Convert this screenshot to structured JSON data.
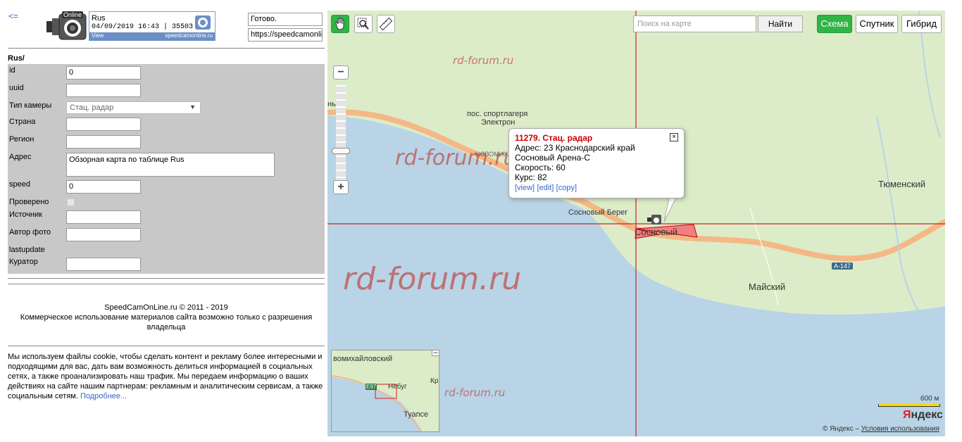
{
  "left": {
    "back_label": "<=",
    "logo_text": "Online",
    "infobox": {
      "country": "Rus",
      "datetime_id": "04/09/2019 16:43 | 35503",
      "view_label": "View",
      "site": "speedcamonline.ru"
    },
    "status": "Готово.",
    "url": "https://speedcamonline.ru",
    "form": {
      "title": "Rus/",
      "fields": {
        "id_label": "id",
        "id_value": "0",
        "uuid_label": "uuid",
        "uuid_value": "",
        "type_label": "Тип камеры",
        "type_value": "Стац. радар",
        "country_label": "Страна",
        "country_value": "",
        "region_label": "Регион",
        "region_value": "",
        "address_label": "Адрес",
        "address_value": "Обзорная карта по таблице Rus",
        "speed_label": "speed",
        "speed_value": "0",
        "checked_label": "Проверено",
        "source_label": "Источник",
        "source_value": "",
        "photo_author_label": "Автор фото",
        "photo_author_value": "",
        "lastupdate_label": "lastupdate",
        "curator_label": "Куратор",
        "curator_value": ""
      }
    },
    "footer": {
      "line1": "SpeedCamOnLine.ru © 2011 - 2019",
      "line2": "Коммерческое использование материалов сайта возможно только с разрешения владельца"
    },
    "cookie": {
      "text": "Мы используем файлы cookie, чтобы сделать контент и рекламу более интересными и подходящими для вас, дать вам возможность делиться информацией в социальных сетях, а также проанализировать наш трафик. Мы передаем информацию о ваших действиях на сайте нашим партнерам: рекламным и аналитическим сервисам, а также социальным сетям. ",
      "more_link": "Подробнее..."
    }
  },
  "map": {
    "search_placeholder": "Поиск на карте",
    "search_button": "Найти",
    "types": {
      "scheme": "Схема",
      "satellite": "Спутник",
      "hybrid": "Гибрид"
    },
    "zoom_plus": "+",
    "zoom_minus": "−",
    "watermark": "rd-forum.ru",
    "labels": {
      "camp": "пос. спортлагеря",
      "electron": "Электрон",
      "novomikh": "НОВОМИХ",
      "sosnoviy_bereg": "Сосновый Берег",
      "sosnoviy": "Сосновый",
      "tyumensky": "Тюменский",
      "maysky": "Майский",
      "road": "А-147",
      "left_edge": "нь"
    },
    "popup": {
      "title": "11279. Стац. радар",
      "address": "Адрес: 23 Краснодарский край",
      "address2": "Сосновый Арена-С",
      "speed": "Скорость: 60",
      "course": "Курс: 82",
      "link_view": "[view]",
      "link_edit": "[edit]",
      "link_copy": "[copy]",
      "close": "×"
    },
    "minimap": {
      "label1": "вомихайловский",
      "label2": "Небуг",
      "label3": "Туапсе",
      "label4": "Кр",
      "road": "E97",
      "minus": "−"
    },
    "scale": "600 м",
    "logo": "Яндекс",
    "copyright_text": "© Яндекс – ",
    "copyright_link": "Условия использования"
  },
  "colors": {
    "accent_green": "#2fb446",
    "water": "#b8d4e6",
    "land": "#dcecc8",
    "road": "#f4b886",
    "crosshair": "#d42020"
  }
}
